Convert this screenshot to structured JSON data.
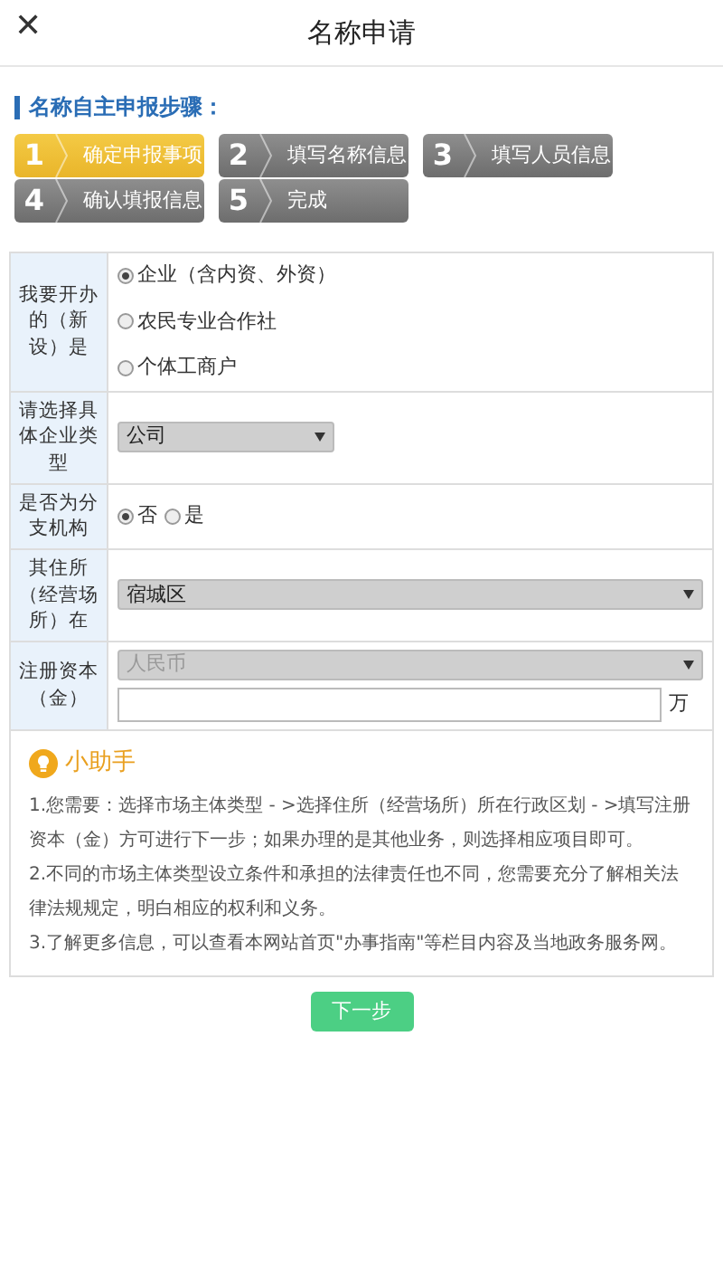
{
  "header": {
    "close": "✕",
    "title": "名称申请"
  },
  "steps_heading": "名称自主申报步骤：",
  "steps": [
    {
      "number": "1",
      "label": "确定申报事项",
      "selected": true
    },
    {
      "number": "2",
      "label": "填写名称信息",
      "selected": false
    },
    {
      "number": "3",
      "label": "填写人员信息",
      "selected": false
    },
    {
      "number": "4",
      "label": "确认填报信息",
      "selected": false
    },
    {
      "number": "5",
      "label": "完成",
      "selected": false
    }
  ],
  "form": [
    {
      "kind": "radio-stacked",
      "label": "我要开办的（新设）是",
      "options": [
        {
          "text": "企业（含内资、外资）",
          "selected": true
        },
        {
          "text": "农民专业合作社",
          "selected": false
        },
        {
          "text": "个体工商户",
          "selected": false
        }
      ]
    },
    {
      "kind": "select-short",
      "label": "请选择具体企业类型",
      "value": "公司"
    },
    {
      "kind": "radio-inline",
      "label": "是否为分支机构",
      "options": [
        {
          "text": "否",
          "selected": true
        },
        {
          "text": "是",
          "selected": false
        }
      ]
    },
    {
      "kind": "select-wide",
      "label": "其住所（经营场所）在",
      "value": "宿城区"
    },
    {
      "kind": "money",
      "label": "注册资本（金）",
      "currency": "人民币",
      "currency_disabled": true,
      "unit": "万"
    }
  ],
  "helper": {
    "title": "小助手",
    "lines": [
      "1.您需要：选择市场主体类型 - >选择住所（经营场所）所在行政区划 - >填写注册资本（金）方可进行下一步；如果办理的是其他业务，则选择相应项目即可。",
      "2.不同的市场主体类型设立条件和承担的法律责任也不同，您需要充分了解相关法律法规规定，明白相应的权利和义务。",
      "3.了解更多信息，可以查看本网站首页\"办事指南\"等栏目内容及当地政务服务网。"
    ]
  },
  "next_button": "下一步"
}
